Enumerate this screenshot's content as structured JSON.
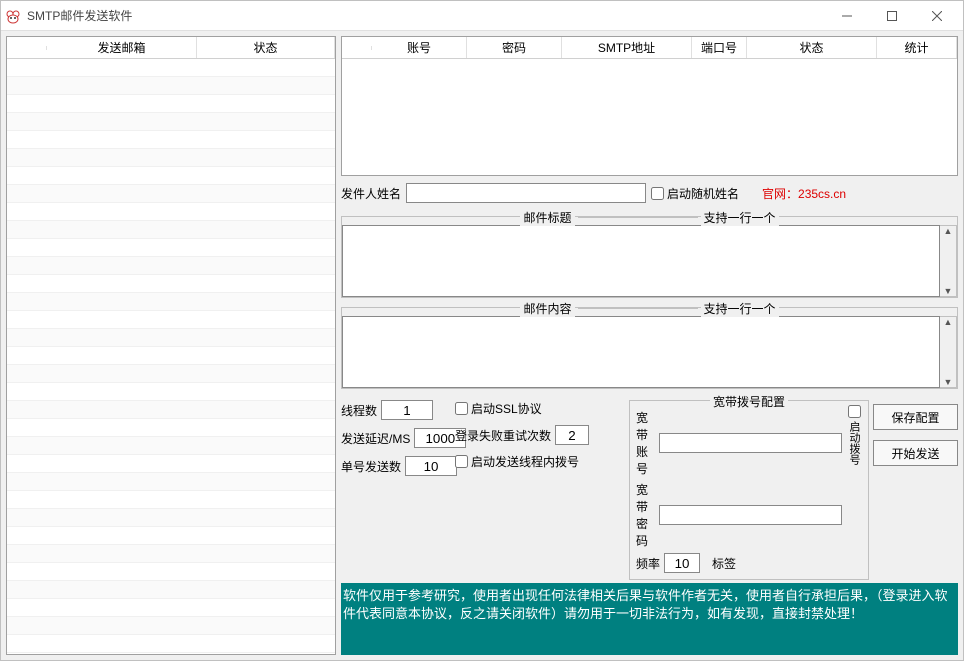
{
  "window": {
    "title": "SMTP邮件发送软件"
  },
  "leftTable": {
    "headers": [
      "发送邮箱",
      "状态"
    ]
  },
  "smtpTable": {
    "headers": [
      "账号",
      "密码",
      "SMTP地址",
      "端口号",
      "状态",
      "统计"
    ]
  },
  "sender": {
    "nameLabel": "发件人姓名",
    "nameValue": "",
    "randomNameLabel": "启动随机姓名",
    "siteLink": "官网：235cs.cn"
  },
  "subjectSection": {
    "label": "邮件标题",
    "hint": "支持一行一个",
    "value": ""
  },
  "bodySection": {
    "label": "邮件内容",
    "hint": "支持一行一个",
    "value": ""
  },
  "config": {
    "threadsLabel": "线程数",
    "threadsValue": "1",
    "delayLabel": "发送延迟/MS",
    "delayValue": "1000",
    "perAccountLabel": "单号发送数",
    "perAccountValue": "10",
    "sslLabel": "启动SSL协议",
    "retryLabel": "登录失败重试次数",
    "retryValue": "2",
    "dialInThreadLabel": "启动发送线程内拨号"
  },
  "dial": {
    "legend": "宽带拨号配置",
    "accountLabel": "宽带账号",
    "accountValue": "",
    "passwordLabel": "宽带密码",
    "passwordValue": "",
    "freqLabel": "频率",
    "freqValue": "10",
    "tagLabel": "标签",
    "enableLabel": "启动拨号"
  },
  "buttons": {
    "save": "保存配置",
    "start": "开始发送"
  },
  "disclaimer": "软件仅用于参考研究，使用者出现任何法律相关后果与软件作者无关，使用者自行承担后果，（登录进入软件代表同意本协议，反之请关闭软件）请勿用于一切非法行为，如有发现，直接封禁处理！"
}
